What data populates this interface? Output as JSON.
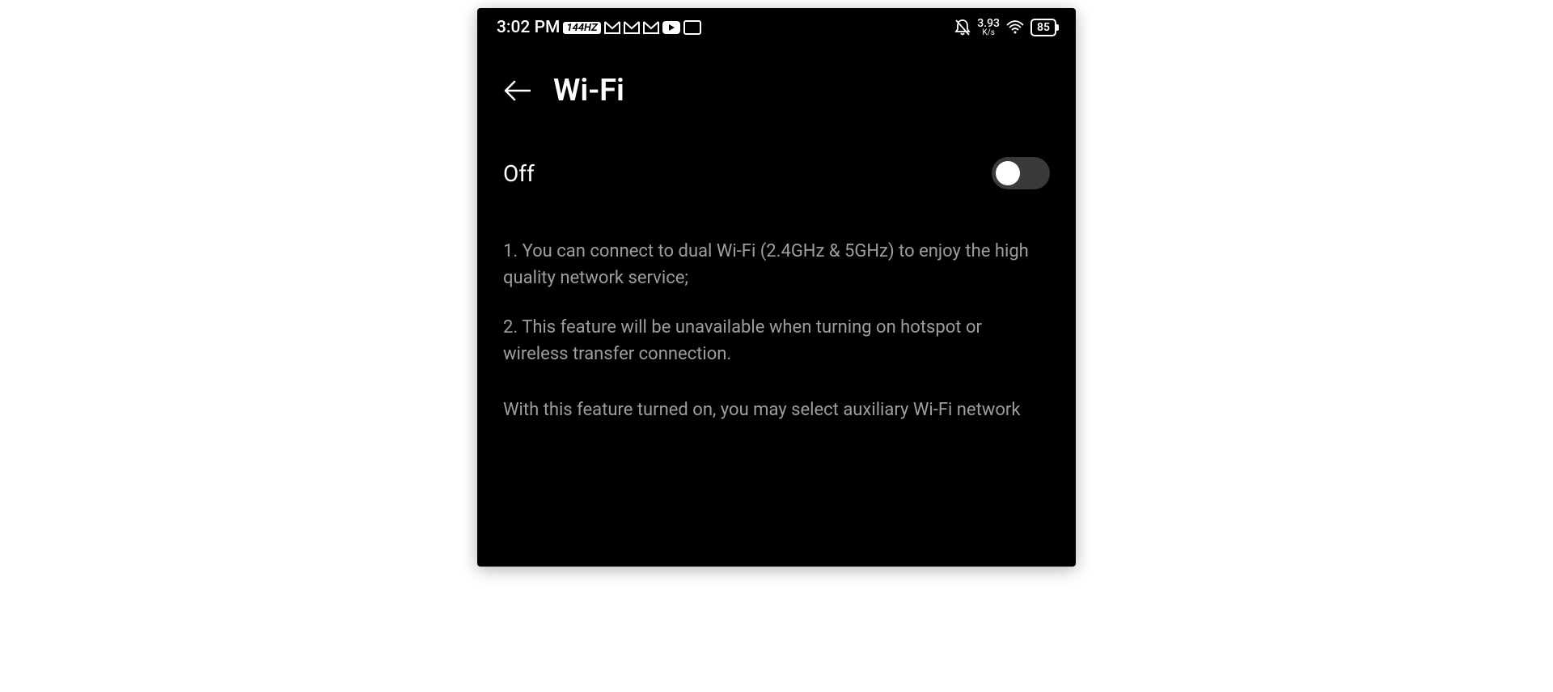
{
  "statusBar": {
    "time": "3:02 PM",
    "refreshRate": "144HZ",
    "netSpeedValue": "3.93",
    "netSpeedUnit": "K/s",
    "batteryPercent": "85"
  },
  "header": {
    "title": "Wi-Fi"
  },
  "toggle": {
    "stateLabel": "Off",
    "enabled": false
  },
  "info": {
    "line1": "1. You can connect to dual Wi-Fi (2.4GHz & 5GHz) to enjoy the high quality network service;",
    "line2": "2. This feature will be unavailable when turning on hotspot or wireless transfer connection.",
    "line3": "With this feature turned on, you may select auxiliary Wi-Fi network"
  }
}
